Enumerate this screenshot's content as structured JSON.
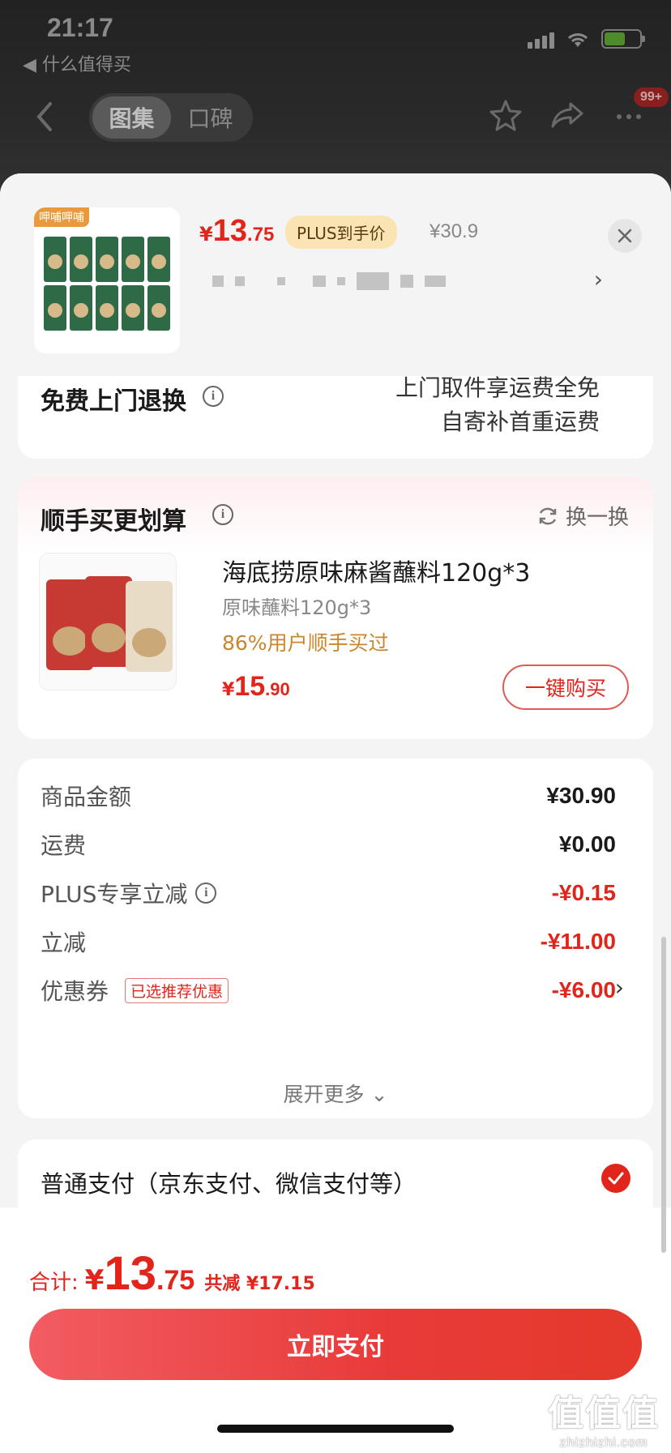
{
  "status_bar": {
    "time": "21:17",
    "back_app": "◀ 什么值得买"
  },
  "nav": {
    "tabs": [
      {
        "label": "图集",
        "active": true
      },
      {
        "label": "口碑",
        "active": false
      }
    ],
    "badge": "99+"
  },
  "product": {
    "thumb_tag": "呷哺呷哺",
    "price": {
      "currency": "¥",
      "integer": "13",
      "decimal": ".75"
    },
    "plus_tag": "PLUS到手价",
    "original_price": "¥30.9"
  },
  "returns": {
    "title": "免费上门退换",
    "line1": "上门取件享运费全免",
    "line2": "自寄补首重运费"
  },
  "addon": {
    "title": "顺手买更划算",
    "refresh_label": "换一换",
    "name": "海底捞原味麻酱蘸料120g*3",
    "spec": "原味蘸料120g*3",
    "bought": "86%用户顺手买过",
    "price": {
      "currency": "¥",
      "integer": "15",
      "decimal": ".90"
    },
    "buy_button": "一键购买"
  },
  "summary": {
    "rows": [
      {
        "label": "商品金额",
        "value": "¥30.90",
        "red": false
      },
      {
        "label": "运费",
        "value": "¥0.00",
        "red": false
      },
      {
        "label": "PLUS专享立减",
        "value": "-¥0.15",
        "red": true
      },
      {
        "label": "立减",
        "value": "-¥11.00",
        "red": true
      },
      {
        "label": "优惠券",
        "value": "-¥6.00",
        "red": true
      }
    ],
    "coupon_tag": "已选推荐优惠",
    "expand_label": "展开更多"
  },
  "payment": {
    "label": "普通支付（京东支付、微信支付等）",
    "selected": true
  },
  "footer": {
    "total_label": "合计:",
    "total": {
      "currency": "¥",
      "integer": "13",
      "decimal": ".75"
    },
    "saved": "共减 ¥17.15",
    "pay_button": "立即支付"
  },
  "watermark": {
    "big": "值值值",
    "small": "zhizhizhi.com"
  },
  "colors": {
    "accent": "#e1251b",
    "plus_tag_bg": "#fbe4b4",
    "bought_text": "#c8872c"
  }
}
